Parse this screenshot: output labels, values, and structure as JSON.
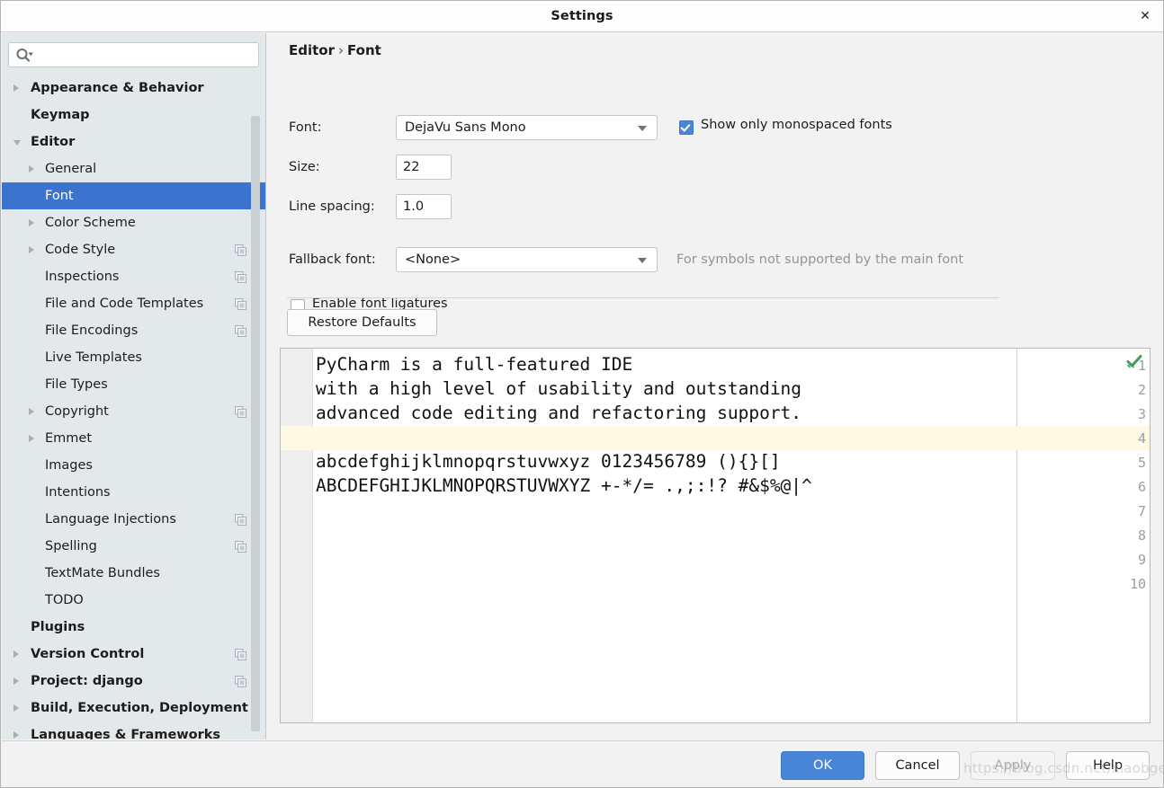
{
  "window": {
    "title": "Settings",
    "close_label": "✕"
  },
  "sidebar": {
    "search": {
      "value": "",
      "placeholder": "",
      "icon": "search-icon"
    },
    "items": [
      {
        "label": "Appearance & Behavior",
        "depth": 0,
        "arrow": "collapsed",
        "bold": true,
        "copy": false,
        "selected": false
      },
      {
        "label": "Keymap",
        "depth": 0,
        "arrow": "none",
        "bold": true,
        "copy": false,
        "selected": false
      },
      {
        "label": "Editor",
        "depth": 0,
        "arrow": "expanded",
        "bold": true,
        "copy": false,
        "selected": false
      },
      {
        "label": "General",
        "depth": 1,
        "arrow": "collapsed",
        "bold": false,
        "copy": false,
        "selected": false
      },
      {
        "label": "Font",
        "depth": 1,
        "arrow": "none",
        "bold": false,
        "copy": false,
        "selected": true
      },
      {
        "label": "Color Scheme",
        "depth": 1,
        "arrow": "collapsed",
        "bold": false,
        "copy": false,
        "selected": false
      },
      {
        "label": "Code Style",
        "depth": 1,
        "arrow": "collapsed",
        "bold": false,
        "copy": true,
        "selected": false
      },
      {
        "label": "Inspections",
        "depth": 1,
        "arrow": "none",
        "bold": false,
        "copy": true,
        "selected": false
      },
      {
        "label": "File and Code Templates",
        "depth": 1,
        "arrow": "none",
        "bold": false,
        "copy": true,
        "selected": false
      },
      {
        "label": "File Encodings",
        "depth": 1,
        "arrow": "none",
        "bold": false,
        "copy": true,
        "selected": false
      },
      {
        "label": "Live Templates",
        "depth": 1,
        "arrow": "none",
        "bold": false,
        "copy": false,
        "selected": false
      },
      {
        "label": "File Types",
        "depth": 1,
        "arrow": "none",
        "bold": false,
        "copy": false,
        "selected": false
      },
      {
        "label": "Copyright",
        "depth": 1,
        "arrow": "collapsed",
        "bold": false,
        "copy": true,
        "selected": false
      },
      {
        "label": "Emmet",
        "depth": 1,
        "arrow": "collapsed",
        "bold": false,
        "copy": false,
        "selected": false
      },
      {
        "label": "Images",
        "depth": 1,
        "arrow": "none",
        "bold": false,
        "copy": false,
        "selected": false
      },
      {
        "label": "Intentions",
        "depth": 1,
        "arrow": "none",
        "bold": false,
        "copy": false,
        "selected": false
      },
      {
        "label": "Language Injections",
        "depth": 1,
        "arrow": "none",
        "bold": false,
        "copy": true,
        "selected": false
      },
      {
        "label": "Spelling",
        "depth": 1,
        "arrow": "none",
        "bold": false,
        "copy": true,
        "selected": false
      },
      {
        "label": "TextMate Bundles",
        "depth": 1,
        "arrow": "none",
        "bold": false,
        "copy": false,
        "selected": false
      },
      {
        "label": "TODO",
        "depth": 1,
        "arrow": "none",
        "bold": false,
        "copy": false,
        "selected": false
      },
      {
        "label": "Plugins",
        "depth": 0,
        "arrow": "none",
        "bold": true,
        "copy": false,
        "selected": false
      },
      {
        "label": "Version Control",
        "depth": 0,
        "arrow": "collapsed",
        "bold": true,
        "copy": true,
        "selected": false
      },
      {
        "label": "Project: django",
        "depth": 0,
        "arrow": "collapsed",
        "bold": true,
        "copy": true,
        "selected": false
      },
      {
        "label": "Build, Execution, Deployment",
        "depth": 0,
        "arrow": "collapsed",
        "bold": true,
        "copy": false,
        "selected": false
      },
      {
        "label": "Languages & Frameworks",
        "depth": 0,
        "arrow": "collapsed",
        "bold": true,
        "copy": false,
        "selected": false
      }
    ]
  },
  "main": {
    "breadcrumb": {
      "parent": "Editor",
      "separator": "›",
      "current": "Font"
    },
    "font": {
      "label": "Font:",
      "value": "DejaVu Sans Mono"
    },
    "size": {
      "label": "Size:",
      "value": "22"
    },
    "line_spacing": {
      "label": "Line spacing:",
      "value": "1.0"
    },
    "fallback_font": {
      "label": "Fallback font:",
      "value": "<None>",
      "hint": "For symbols not supported by the main font"
    },
    "show_monospaced": {
      "label": "Show only monospaced fonts",
      "checked": true
    },
    "ligatures": {
      "label": "Enable font ligatures",
      "checked": false
    },
    "restore_defaults_label": "Restore Defaults"
  },
  "editor_preview": {
    "status_icon": "green-check-icon",
    "caret_line": 4,
    "line_numbers": [
      "1",
      "2",
      "3",
      "4",
      "5",
      "6",
      "7",
      "8",
      "9",
      "10"
    ],
    "lines": [
      "PyCharm is a full-featured IDE",
      "with a high level of usability and outstanding",
      "advanced code editing and refactoring support.",
      "",
      "abcdefghijklmnopqrstuvwxyz 0123456789 (){}[]",
      "ABCDEFGHIJKLMNOPQRSTUVWXYZ +-*/= .,;:!? #&$%@|^",
      "",
      "",
      "",
      ""
    ]
  },
  "footer": {
    "ok": "OK",
    "cancel": "Cancel",
    "apply": "Apply",
    "help": "Help"
  },
  "watermark": "https://blog.csdn.net/xiaobgeldx",
  "colors": {
    "accent": "#4a86d8",
    "selection": "#3b73cf",
    "sidebar_bg": "#e3e8ea",
    "panel_bg": "#f2f2f2",
    "caret_line": "#fdf9e4",
    "status_green": "#3f9d58"
  }
}
